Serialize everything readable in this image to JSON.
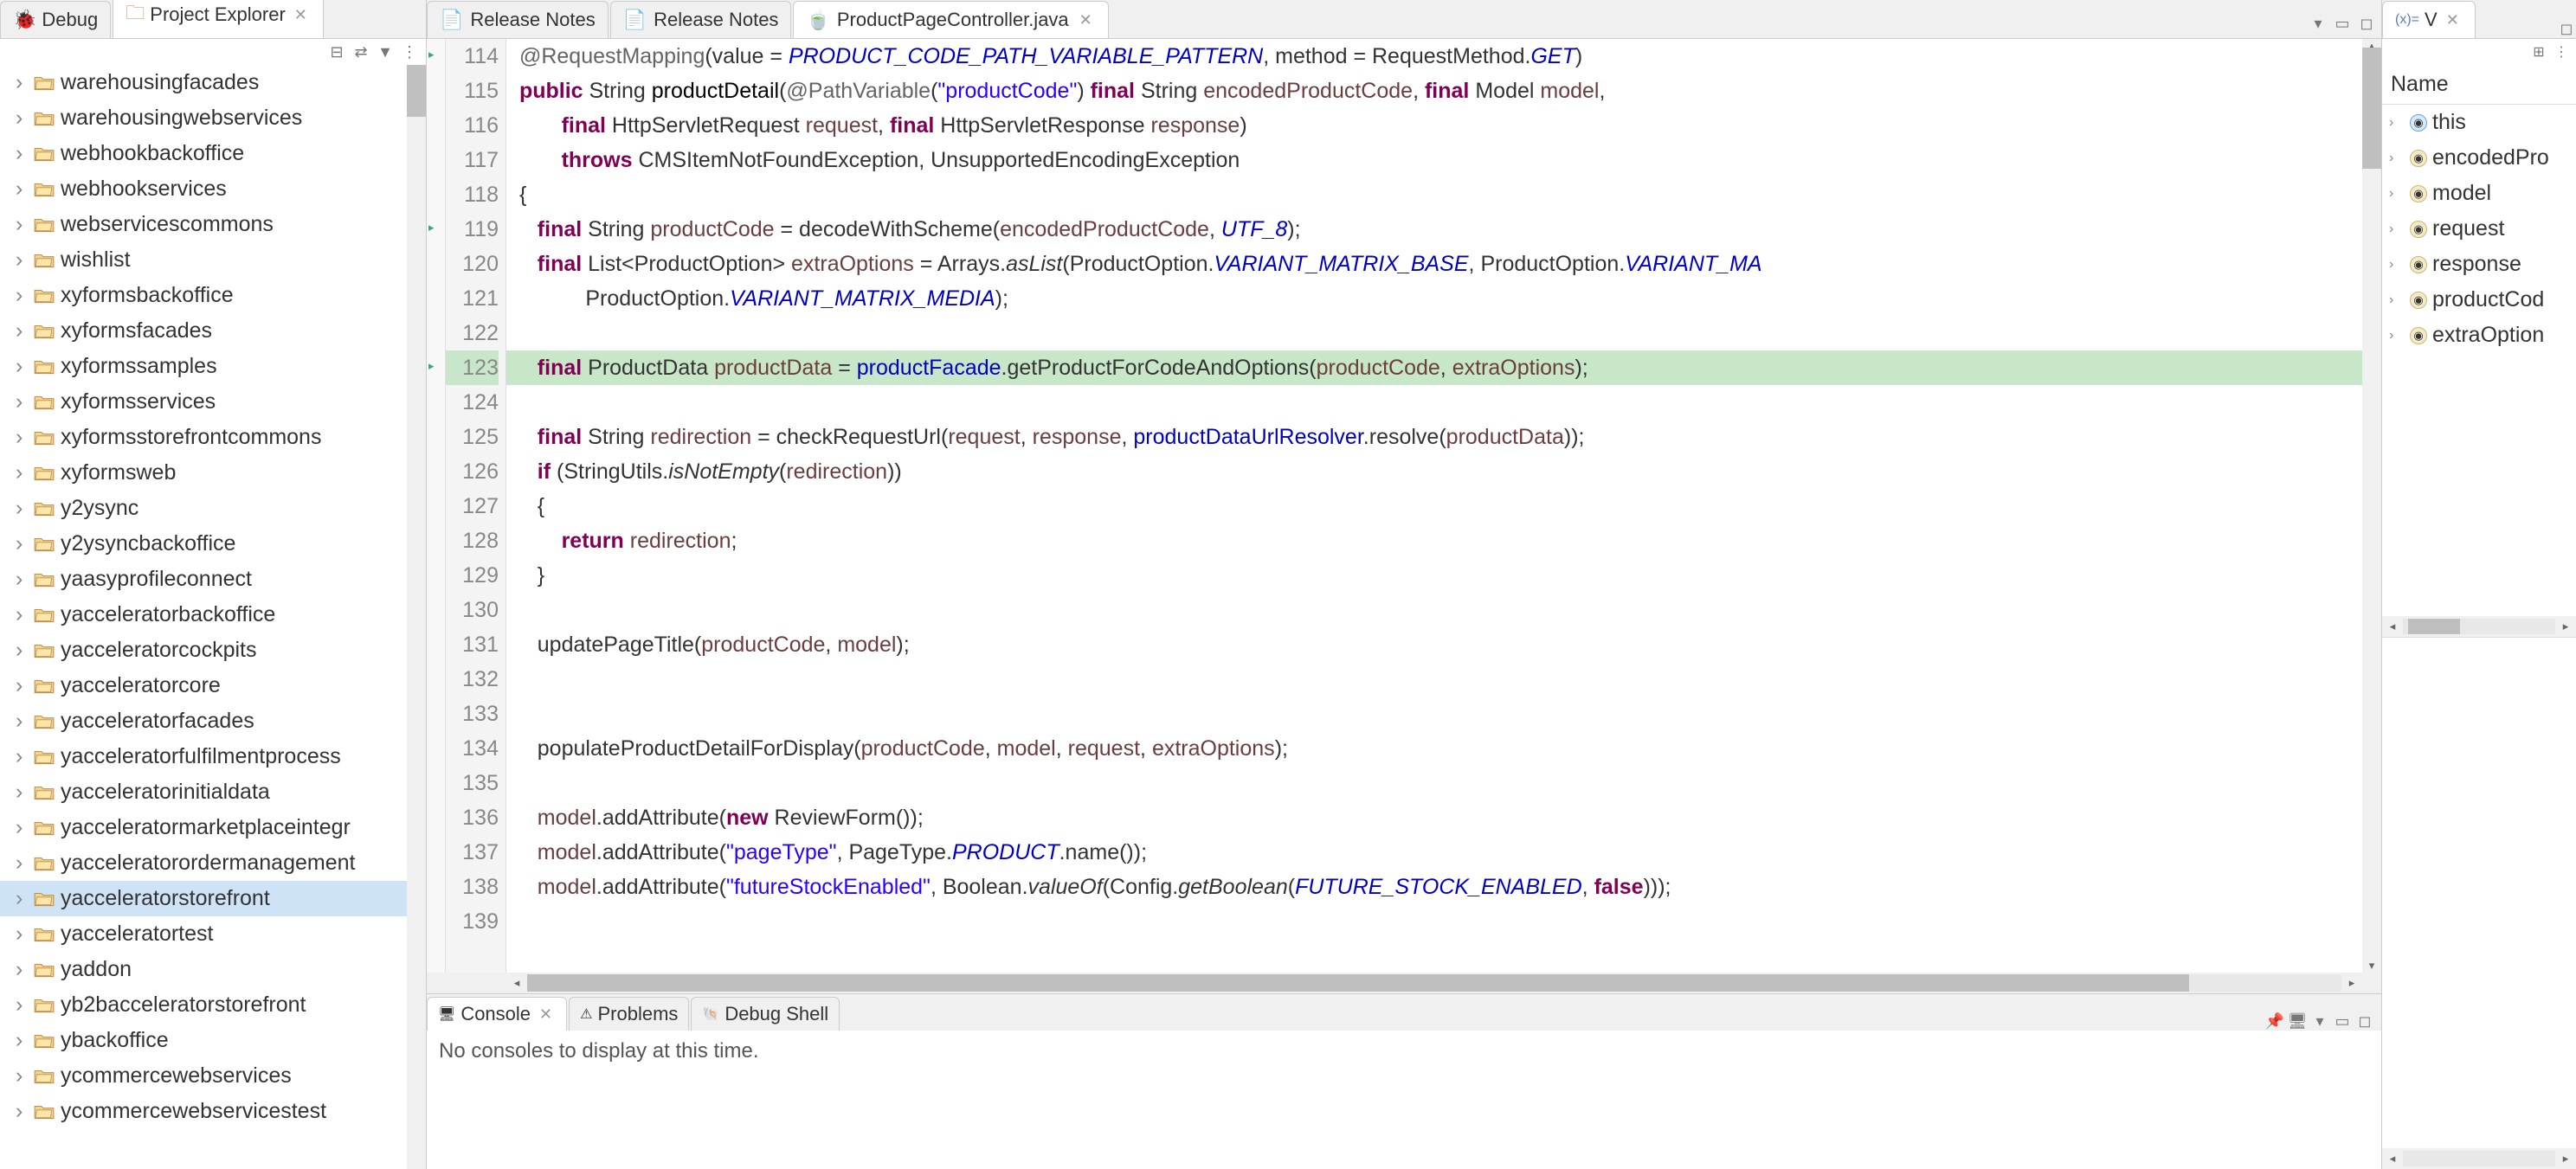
{
  "leftPanel": {
    "tabs": [
      {
        "label": "Debug",
        "icon": "debug"
      },
      {
        "label": "Project Explorer",
        "icon": "project",
        "active": true
      }
    ],
    "treeItems": [
      "warehousingfacades",
      "warehousingwebservices",
      "webhookbackoffice",
      "webhookservices",
      "webservicescommons",
      "wishlist",
      "xyformsbackoffice",
      "xyformsfacades",
      "xyformssamples",
      "xyformsservices",
      "xyformsstorefrontcommons",
      "xyformsweb",
      "y2ysync",
      "y2ysyncbackoffice",
      "yaasyprofileconnect",
      "yacceleratorbackoffice",
      "yacceleratorcockpits",
      "yacceleratorcore",
      "yacceleratorfacades",
      "yacceleratorfulfilmentprocess",
      "yacceleratorinitialdata",
      "yacceleratormarketplaceintegr",
      "yacceleratorordermanagement",
      "yacceleratorstorefront",
      "yacceleratortest",
      "yaddon",
      "yb2bacceleratorstorefront",
      "ybackoffice",
      "ycommercewebservices",
      "ycommercewebservicestest"
    ],
    "selectedIndex": 23
  },
  "editor": {
    "tabs": [
      {
        "label": "Release Notes",
        "icon": "text"
      },
      {
        "label": "Release Notes",
        "icon": "text"
      },
      {
        "label": "ProductPageController.java",
        "icon": "java",
        "active": true
      }
    ],
    "startLine": 114,
    "execLine": 123,
    "lines": [
      {
        "n": 114,
        "marker": "arrow",
        "segs": [
          [
            " ",
            "p"
          ],
          [
            "@RequestMapping",
            "ann"
          ],
          [
            "(value = ",
            "p"
          ],
          [
            "PRODUCT_CODE_PATH_VARIABLE_PATTERN",
            "static-f"
          ],
          [
            ", method = RequestMethod.",
            "p"
          ],
          [
            "GET",
            "static-f"
          ],
          [
            ")",
            "p"
          ]
        ]
      },
      {
        "n": 115,
        "segs": [
          [
            " ",
            "p"
          ],
          [
            "public",
            "kw"
          ],
          [
            " String ",
            "p"
          ],
          [
            "productDetail",
            "method"
          ],
          [
            "(",
            "p"
          ],
          [
            "@PathVariable",
            "ann"
          ],
          [
            "(",
            "p"
          ],
          [
            "\"productCode\"",
            "str"
          ],
          [
            ") ",
            "p"
          ],
          [
            "final",
            "kw"
          ],
          [
            " String ",
            "p"
          ],
          [
            "encodedProductCode",
            "param"
          ],
          [
            ", ",
            "p"
          ],
          [
            "final",
            "kw"
          ],
          [
            " Model ",
            "p"
          ],
          [
            "model",
            "param"
          ],
          [
            ",",
            "p"
          ]
        ]
      },
      {
        "n": 116,
        "segs": [
          [
            "        ",
            "p"
          ],
          [
            "final",
            "kw"
          ],
          [
            " HttpServletRequest ",
            "p"
          ],
          [
            "request",
            "param"
          ],
          [
            ", ",
            "p"
          ],
          [
            "final",
            "kw"
          ],
          [
            " HttpServletResponse ",
            "p"
          ],
          [
            "response",
            "param"
          ],
          [
            ")",
            "p"
          ]
        ]
      },
      {
        "n": 117,
        "segs": [
          [
            "        ",
            "p"
          ],
          [
            "throws",
            "kw"
          ],
          [
            " CMSItemNotFoundException, UnsupportedEncodingException",
            "p"
          ]
        ]
      },
      {
        "n": 118,
        "segs": [
          [
            " {",
            "p"
          ]
        ]
      },
      {
        "n": 119,
        "marker": "arrow",
        "segs": [
          [
            "    ",
            "p"
          ],
          [
            "final",
            "kw"
          ],
          [
            " String ",
            "p"
          ],
          [
            "productCode",
            "local"
          ],
          [
            " = decodeWithScheme(",
            "p"
          ],
          [
            "encodedProductCode",
            "param"
          ],
          [
            ", ",
            "p"
          ],
          [
            "UTF_8",
            "static-f"
          ],
          [
            ");",
            "p"
          ]
        ]
      },
      {
        "n": 120,
        "segs": [
          [
            "    ",
            "p"
          ],
          [
            "final",
            "kw"
          ],
          [
            " List<ProductOption> ",
            "p"
          ],
          [
            "extraOptions",
            "local"
          ],
          [
            " = Arrays.",
            "p"
          ],
          [
            "asList",
            "static-m"
          ],
          [
            "(ProductOption.",
            "p"
          ],
          [
            "VARIANT_MATRIX_BASE",
            "static-f"
          ],
          [
            ", ProductOption.",
            "p"
          ],
          [
            "VARIANT_MA",
            "static-f"
          ]
        ]
      },
      {
        "n": 121,
        "segs": [
          [
            "            ProductOption.",
            "p"
          ],
          [
            "VARIANT_MATRIX_MEDIA",
            "static-f"
          ],
          [
            ");",
            "p"
          ]
        ]
      },
      {
        "n": 122,
        "segs": [
          [
            "",
            "p"
          ]
        ]
      },
      {
        "n": 123,
        "marker": "arrow",
        "exec": true,
        "segs": [
          [
            "    ",
            "p"
          ],
          [
            "final",
            "kw"
          ],
          [
            " ProductData ",
            "p"
          ],
          [
            "productData",
            "local"
          ],
          [
            " = ",
            "p"
          ],
          [
            "productFacade",
            "field"
          ],
          [
            ".getProductForCodeAndOptions(",
            "p"
          ],
          [
            "productCode",
            "local"
          ],
          [
            ", ",
            "p"
          ],
          [
            "extraOptions",
            "local"
          ],
          [
            ");",
            "p"
          ]
        ]
      },
      {
        "n": 124,
        "segs": [
          [
            "",
            "p"
          ]
        ]
      },
      {
        "n": 125,
        "segs": [
          [
            "    ",
            "p"
          ],
          [
            "final",
            "kw"
          ],
          [
            " String ",
            "p"
          ],
          [
            "redirection",
            "local"
          ],
          [
            " = checkRequestUrl(",
            "p"
          ],
          [
            "request",
            "param"
          ],
          [
            ", ",
            "p"
          ],
          [
            "response",
            "param"
          ],
          [
            ", ",
            "p"
          ],
          [
            "productDataUrlResolver",
            "field"
          ],
          [
            ".resolve(",
            "p"
          ],
          [
            "productData",
            "local"
          ],
          [
            "));",
            "p"
          ]
        ]
      },
      {
        "n": 126,
        "segs": [
          [
            "    ",
            "p"
          ],
          [
            "if",
            "kw"
          ],
          [
            " (StringUtils.",
            "p"
          ],
          [
            "isNotEmpty",
            "static-m"
          ],
          [
            "(",
            "p"
          ],
          [
            "redirection",
            "local"
          ],
          [
            "))",
            "p"
          ]
        ]
      },
      {
        "n": 127,
        "segs": [
          [
            "    {",
            "p"
          ]
        ]
      },
      {
        "n": 128,
        "segs": [
          [
            "        ",
            "p"
          ],
          [
            "return",
            "kw"
          ],
          [
            " ",
            "p"
          ],
          [
            "redirection",
            "local"
          ],
          [
            ";",
            "p"
          ]
        ]
      },
      {
        "n": 129,
        "segs": [
          [
            "    }",
            "p"
          ]
        ]
      },
      {
        "n": 130,
        "segs": [
          [
            "",
            "p"
          ]
        ]
      },
      {
        "n": 131,
        "segs": [
          [
            "    updatePageTitle(",
            "p"
          ],
          [
            "productCode",
            "local"
          ],
          [
            ", ",
            "p"
          ],
          [
            "model",
            "param"
          ],
          [
            ");",
            "p"
          ]
        ]
      },
      {
        "n": 132,
        "segs": [
          [
            "",
            "p"
          ]
        ]
      },
      {
        "n": 133,
        "segs": [
          [
            "",
            "p"
          ]
        ]
      },
      {
        "n": 134,
        "segs": [
          [
            "    populateProductDetailForDisplay(",
            "p"
          ],
          [
            "productCode",
            "local"
          ],
          [
            ", ",
            "p"
          ],
          [
            "model",
            "param"
          ],
          [
            ", ",
            "p"
          ],
          [
            "request",
            "param"
          ],
          [
            ", ",
            "p"
          ],
          [
            "extraOptions",
            "local"
          ],
          [
            ");",
            "p"
          ]
        ]
      },
      {
        "n": 135,
        "segs": [
          [
            "",
            "p"
          ]
        ]
      },
      {
        "n": 136,
        "segs": [
          [
            "    ",
            "p"
          ],
          [
            "model",
            "param"
          ],
          [
            ".addAttribute(",
            "p"
          ],
          [
            "new",
            "kw"
          ],
          [
            " ReviewForm());",
            "p"
          ]
        ]
      },
      {
        "n": 137,
        "segs": [
          [
            "    ",
            "p"
          ],
          [
            "model",
            "param"
          ],
          [
            ".addAttribute(",
            "p"
          ],
          [
            "\"pageType\"",
            "str"
          ],
          [
            ", PageType.",
            "p"
          ],
          [
            "PRODUCT",
            "static-f"
          ],
          [
            ".name());",
            "p"
          ]
        ]
      },
      {
        "n": 138,
        "segs": [
          [
            "    ",
            "p"
          ],
          [
            "model",
            "param"
          ],
          [
            ".addAttribute(",
            "p"
          ],
          [
            "\"futureStockEnabled\"",
            "str"
          ],
          [
            ", Boolean.",
            "p"
          ],
          [
            "valueOf",
            "static-m"
          ],
          [
            "(Config.",
            "p"
          ],
          [
            "getBoolean",
            "static-m"
          ],
          [
            "(",
            "p"
          ],
          [
            "FUTURE_STOCK_ENABLED",
            "static-f"
          ],
          [
            ", ",
            "p"
          ],
          [
            "false",
            "kw"
          ],
          [
            ")));",
            "p"
          ]
        ]
      },
      {
        "n": 139,
        "segs": [
          [
            "",
            "p"
          ]
        ]
      }
    ]
  },
  "console": {
    "tabs": [
      {
        "label": "Console",
        "active": true
      },
      {
        "label": "Problems"
      },
      {
        "label": "Debug Shell"
      }
    ],
    "message": "No consoles to display at this time."
  },
  "variables": {
    "viewLabel": "V",
    "header": "Name",
    "items": [
      {
        "name": "this",
        "kind": "this"
      },
      {
        "name": "encodedPro",
        "kind": "local"
      },
      {
        "name": "model",
        "kind": "local"
      },
      {
        "name": "request",
        "kind": "local"
      },
      {
        "name": "response",
        "kind": "local"
      },
      {
        "name": "productCod",
        "kind": "local"
      },
      {
        "name": "extraOption",
        "kind": "local"
      }
    ]
  }
}
